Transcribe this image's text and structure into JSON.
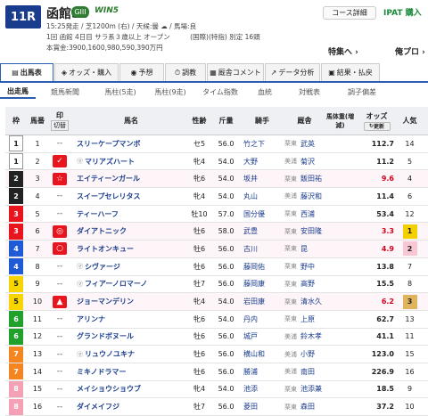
{
  "race": {
    "number": "11R",
    "name": "函館SS",
    "grade": "GIII",
    "win5": "WIN5",
    "line1": "15:25発走 / 芝1200m (右) / 天候:曇 ☁ / 馬場:良",
    "line2": "1回 函館 4日目 サラ系３歳以上 オープン　　　(国際)(特指) 別定 16頭",
    "line3": "本賞金:3900,1600,980,590,390万円",
    "course_btn": "コース詳細",
    "ipat": "IPAT 購入",
    "special": "特集へ ›",
    "ore": "俺プロ ›"
  },
  "tabs": [
    {
      "icon": "▤",
      "label": "出馬表"
    },
    {
      "icon": "◈",
      "label": "オッズ・購入"
    },
    {
      "icon": "◉",
      "label": "予想"
    },
    {
      "icon": "⏱",
      "label": "調教"
    },
    {
      "icon": "▦",
      "label": "厩舎コメント"
    },
    {
      "icon": "↗",
      "label": "データ分析"
    },
    {
      "icon": "▣",
      "label": "結果・払戻"
    }
  ],
  "subtabs": [
    "出走馬",
    "競馬新聞",
    "馬柱(5走)",
    "馬柱(9走)",
    "タイム指数",
    "血統",
    "対戦表",
    "調子偏差"
  ],
  "headers": {
    "waku": "枠",
    "uma": "馬番",
    "mark": "印",
    "mark_sub": "切替",
    "name": "馬名",
    "sex": "性齢",
    "kin": "斤量",
    "jockey": "騎手",
    "stable": "厩舎",
    "weight": "馬体重(増減)",
    "odds": "オッズ",
    "refresh": "更新",
    "pop": "人気"
  },
  "colors": {
    "waku": [
      "#ffffff",
      "#222222",
      "#e8141e",
      "#1f5bd4",
      "#f7d500",
      "#21a02c",
      "#f58520",
      "#f4a0b5"
    ],
    "waku_text": [
      "#222",
      "#fff",
      "#fff",
      "#fff",
      "#222",
      "#fff",
      "#fff",
      "#fff"
    ],
    "fav1": "#f5d000",
    "fav2": "#f9c7d4",
    "fav3": "#e0b45c",
    "highlight_row": "#fdf5f7",
    "mark_red": "#e8141e",
    "odds_red": "#d6001c"
  },
  "rows": [
    {
      "waku": "1",
      "uma": "1",
      "mark": "--",
      "prefix": "",
      "name": "スリーケープマンボ",
      "sex": "セ5",
      "kin": "56.0",
      "jockey": "竹之下",
      "area": "栗東",
      "trainer": "武英",
      "weight": "",
      "odds": "112.7",
      "pop": "14",
      "red": false
    },
    {
      "waku": "1",
      "uma": "2",
      "mark": "✓",
      "prefix": "㋮",
      "name": "マリアズハート",
      "sex": "牝4",
      "kin": "54.0",
      "jockey": "大野",
      "area": "美浦",
      "trainer": "菊沢",
      "weight": "",
      "odds": "11.2",
      "pop": "5",
      "red": false
    },
    {
      "waku": "2",
      "uma": "3",
      "mark": "☆",
      "prefix": "",
      "name": "エイティーンガール",
      "sex": "牝6",
      "kin": "54.0",
      "jockey": "坂井",
      "area": "栗東",
      "trainer": "飯田祐",
      "weight": "",
      "odds": "9.6",
      "pop": "4",
      "red": true
    },
    {
      "waku": "2",
      "uma": "4",
      "mark": "--",
      "prefix": "",
      "name": "スイープセレリタス",
      "sex": "牝4",
      "kin": "54.0",
      "jockey": "丸山",
      "area": "美浦",
      "trainer": "藤沢和",
      "weight": "",
      "odds": "11.4",
      "pop": "6",
      "red": false
    },
    {
      "waku": "3",
      "uma": "5",
      "mark": "--",
      "prefix": "",
      "name": "ティーハーフ",
      "sex": "牡10",
      "kin": "57.0",
      "jockey": "国分優",
      "area": "栗東",
      "trainer": "西浦",
      "weight": "",
      "odds": "53.4",
      "pop": "12",
      "red": false
    },
    {
      "waku": "3",
      "uma": "6",
      "mark": "◎",
      "prefix": "",
      "name": "ダイアトニック",
      "sex": "牡6",
      "kin": "58.0",
      "jockey": "武豊",
      "area": "栗東",
      "trainer": "安田隆",
      "weight": "",
      "odds": "3.3",
      "pop": "1",
      "red": true
    },
    {
      "waku": "4",
      "uma": "7",
      "mark": "○",
      "prefix": "",
      "name": "ライトオンキュー",
      "sex": "牡6",
      "kin": "56.0",
      "jockey": "古川",
      "area": "栗東",
      "trainer": "昆",
      "weight": "",
      "odds": "4.9",
      "pop": "2",
      "red": true
    },
    {
      "waku": "4",
      "uma": "8",
      "mark": "--",
      "prefix": "㋮",
      "name": "シヴァージ",
      "sex": "牡6",
      "kin": "56.0",
      "jockey": "藤岡佑",
      "area": "栗東",
      "trainer": "野中",
      "weight": "",
      "odds": "13.8",
      "pop": "7",
      "red": false
    },
    {
      "waku": "5",
      "uma": "9",
      "mark": "--",
      "prefix": "㋮",
      "name": "フィアーノロマーノ",
      "sex": "牡7",
      "kin": "56.0",
      "jockey": "藤岡康",
      "area": "栗東",
      "trainer": "高野",
      "weight": "",
      "odds": "15.5",
      "pop": "8",
      "red": false
    },
    {
      "waku": "5",
      "uma": "10",
      "mark": "▲",
      "prefix": "",
      "name": "ジョーマンデリン",
      "sex": "牝4",
      "kin": "54.0",
      "jockey": "岩田康",
      "area": "栗東",
      "trainer": "清水久",
      "weight": "",
      "odds": "6.2",
      "pop": "3",
      "red": true
    },
    {
      "waku": "6",
      "uma": "11",
      "mark": "--",
      "prefix": "",
      "name": "アリンナ",
      "sex": "牝6",
      "kin": "54.0",
      "jockey": "丹内",
      "area": "栗東",
      "trainer": "上原",
      "weight": "",
      "odds": "62.7",
      "pop": "13",
      "red": false
    },
    {
      "waku": "6",
      "uma": "12",
      "mark": "--",
      "prefix": "",
      "name": "グランドボヌール",
      "sex": "牡6",
      "kin": "56.0",
      "jockey": "城戸",
      "area": "美浦",
      "trainer": "鈴木孝",
      "weight": "",
      "odds": "41.1",
      "pop": "11",
      "red": false
    },
    {
      "waku": "7",
      "uma": "13",
      "mark": "--",
      "prefix": "㋮",
      "name": "リュウノユキナ",
      "sex": "牡6",
      "kin": "56.0",
      "jockey": "横山和",
      "area": "美浦",
      "trainer": "小野",
      "weight": "",
      "odds": "123.0",
      "pop": "15",
      "red": false
    },
    {
      "waku": "7",
      "uma": "14",
      "mark": "--",
      "prefix": "",
      "name": "ミキノドラマー",
      "sex": "牡6",
      "kin": "56.0",
      "jockey": "勝浦",
      "area": "美浦",
      "trainer": "南田",
      "weight": "",
      "odds": "226.9",
      "pop": "16",
      "red": false
    },
    {
      "waku": "8",
      "uma": "15",
      "mark": "--",
      "prefix": "",
      "name": "メイショウショウブ",
      "sex": "牝4",
      "kin": "54.0",
      "jockey": "池添",
      "area": "栗東",
      "trainer": "池添兼",
      "weight": "",
      "odds": "18.5",
      "pop": "9",
      "red": false
    },
    {
      "waku": "8",
      "uma": "16",
      "mark": "--",
      "prefix": "",
      "name": "ダイメイフジ",
      "sex": "牡7",
      "kin": "56.0",
      "jockey": "菱田",
      "area": "栗東",
      "trainer": "森田",
      "weight": "",
      "odds": "37.2",
      "pop": "10",
      "red": false
    }
  ]
}
